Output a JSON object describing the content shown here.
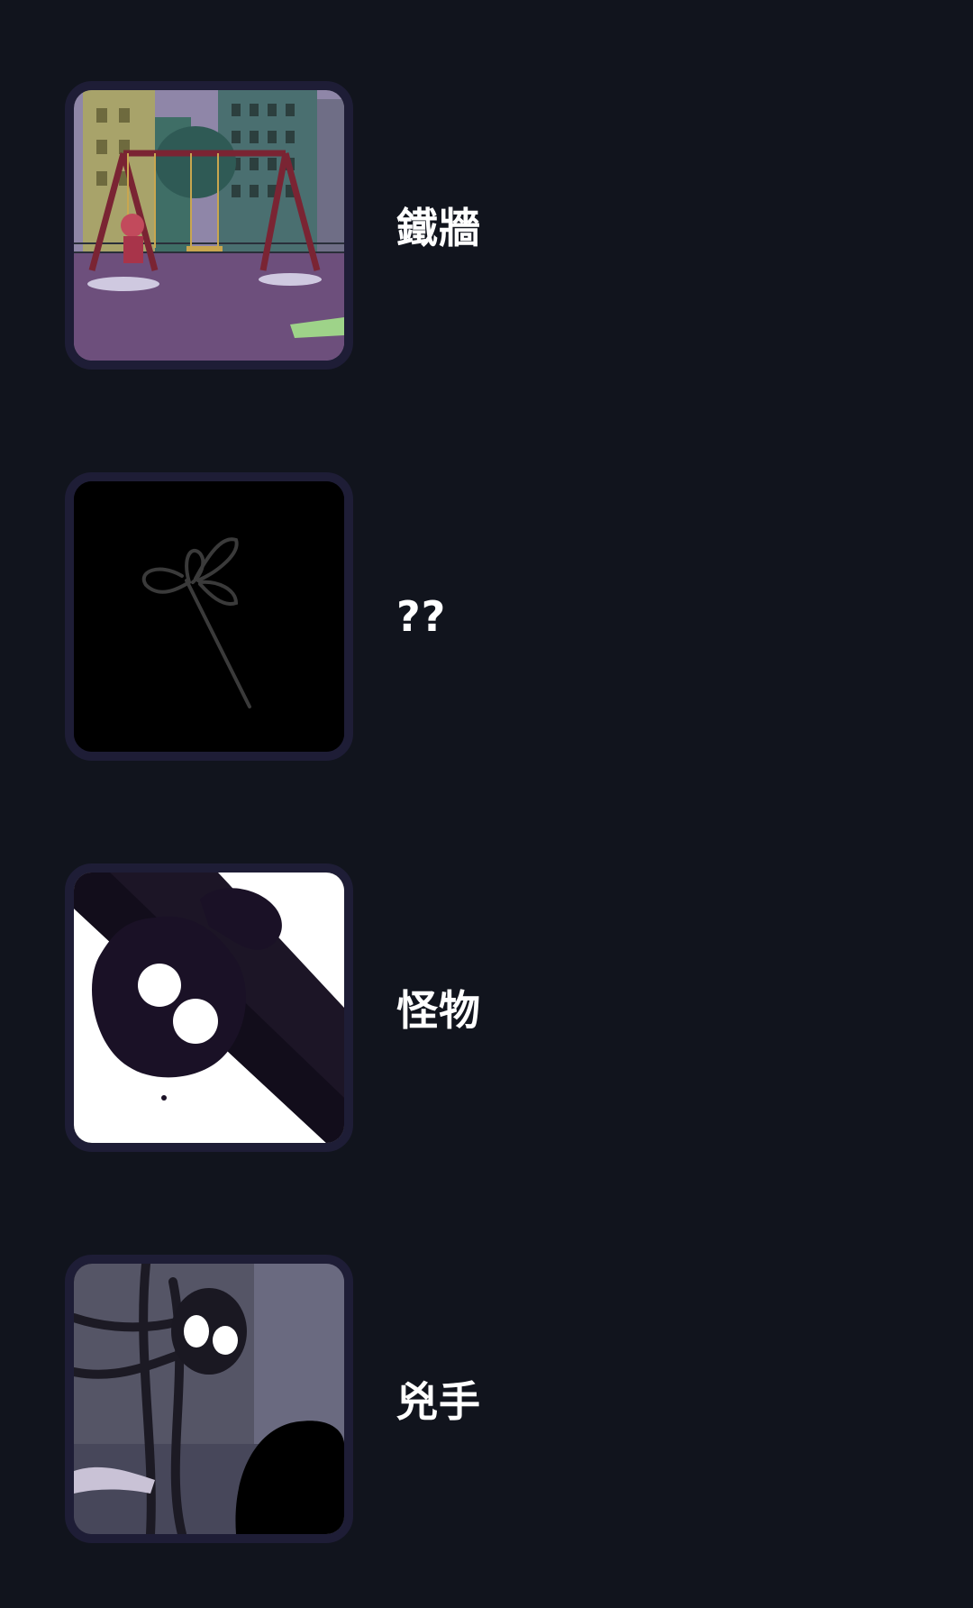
{
  "items": [
    {
      "title": "鐵牆",
      "thumbnail": "playground-swing-scene-image"
    },
    {
      "title": "??",
      "thumbnail": "dark-flower-silhouette-image"
    },
    {
      "title": "怪物",
      "thumbnail": "shadow-monster-image"
    },
    {
      "title": "兇手",
      "thumbnail": "dark-figures-scene-image"
    }
  ],
  "colors": {
    "background": "#11141d",
    "thumb_border": "#1e1d36",
    "text": "#ffffff"
  }
}
